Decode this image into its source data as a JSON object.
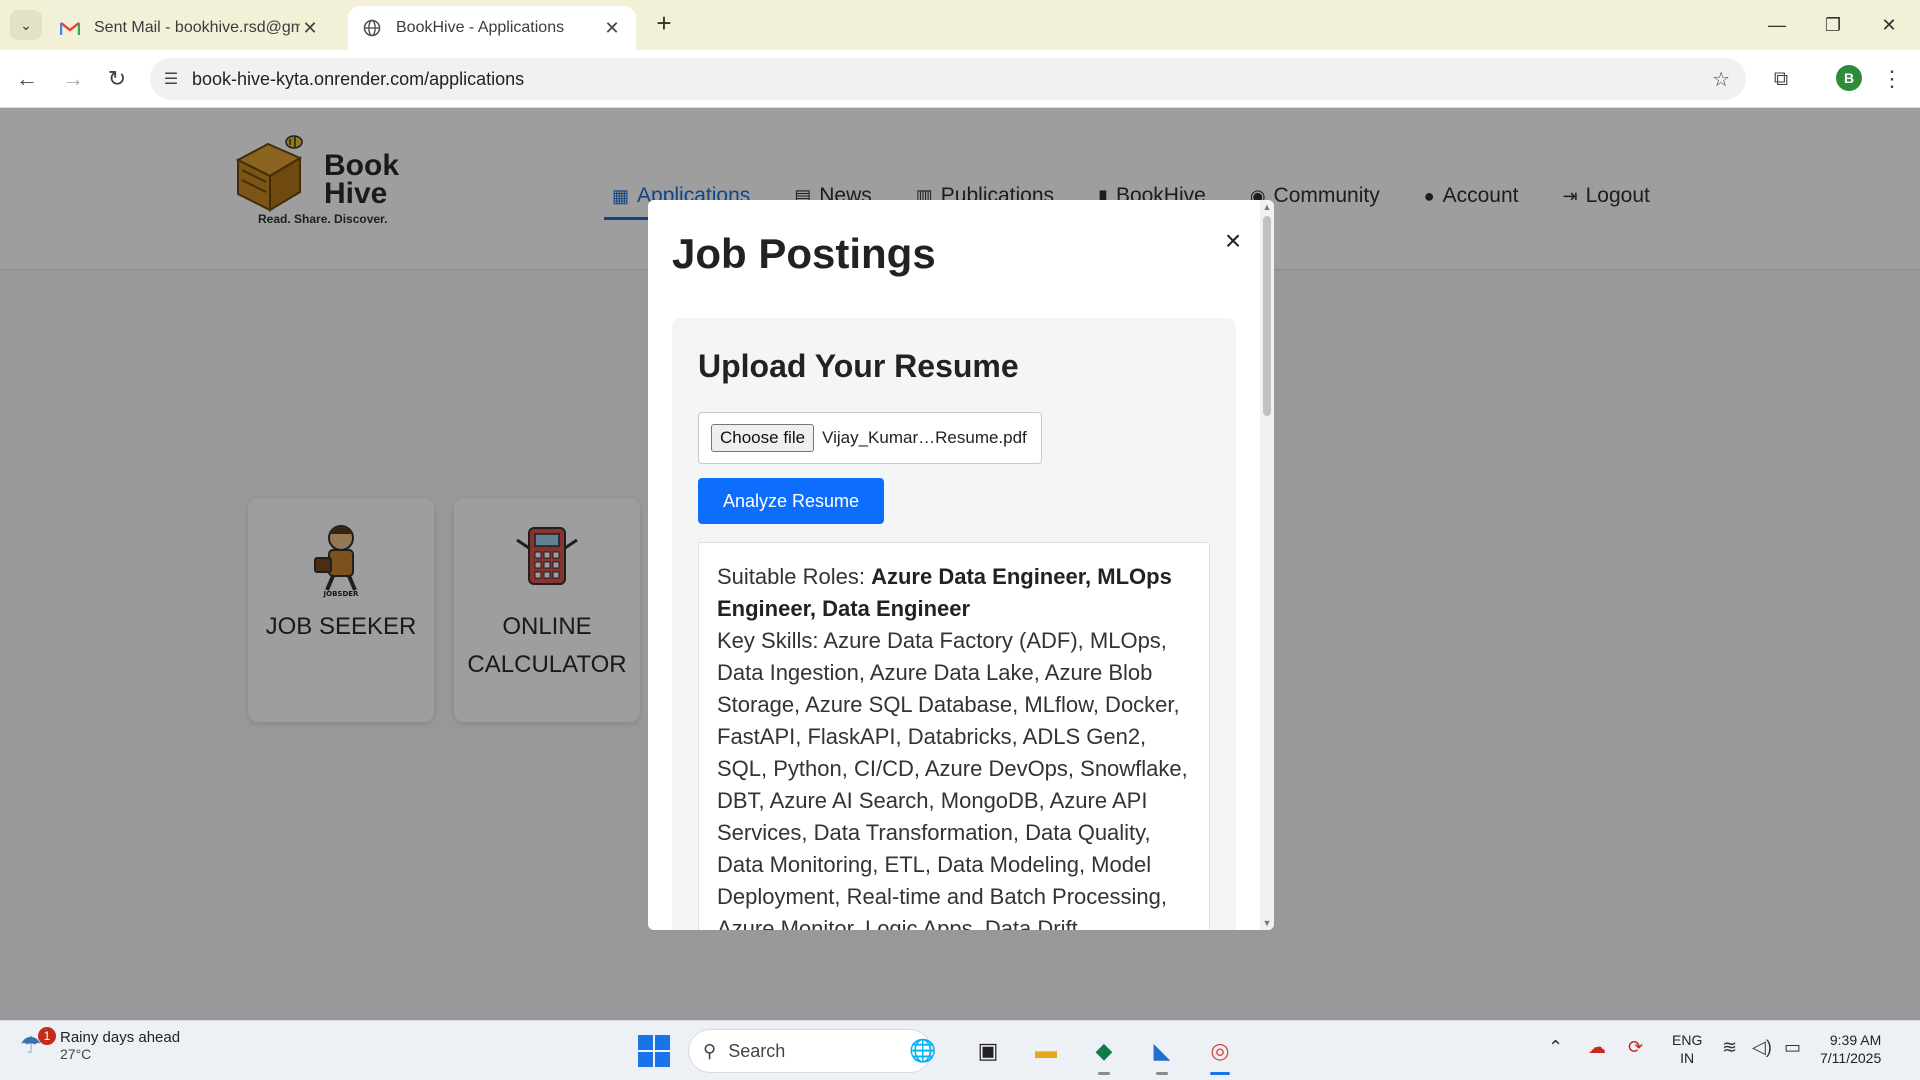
{
  "browser": {
    "tabs": [
      {
        "title": "Sent Mail - bookhive.rsd@gmail.com - Gmail",
        "icon": "gmail-icon",
        "active": false
      },
      {
        "title": "BookHive - Applications",
        "icon": "globe-icon",
        "active": true
      }
    ],
    "url": "book-hive-kyta.onrender.com/applications",
    "profile_initial": "B"
  },
  "site": {
    "logo": {
      "name_line1": "Book",
      "name_line2": "Hive",
      "tagline": "Read. Share. Discover."
    },
    "nav": [
      {
        "label": "Applications",
        "icon": "grid-icon",
        "active": true
      },
      {
        "label": "News",
        "icon": "newspaper-icon",
        "active": false
      },
      {
        "label": "Publications",
        "icon": "book-open-icon",
        "active": false
      },
      {
        "label": "BookHive",
        "icon": "book-icon",
        "active": false
      },
      {
        "label": "Community",
        "icon": "comments-icon",
        "active": false
      },
      {
        "label": "Account",
        "icon": "user-icon",
        "active": false
      },
      {
        "label": "Logout",
        "icon": "logout-icon",
        "active": false
      }
    ],
    "apps": [
      {
        "label": "JOB SEEKER",
        "icon": "job-seeker-icon"
      },
      {
        "label": "ONLINE CALCULATOR",
        "icon": "calculator-icon"
      }
    ]
  },
  "modal": {
    "title": "Job Postings",
    "close_label": "×",
    "upload": {
      "title": "Upload Your Resume",
      "choose_label": "Choose file",
      "file_name": "Vijay_Kumar…Resume.pdf",
      "analyze_label": "Analyze Resume"
    },
    "result": {
      "roles_label": "Suitable Roles:",
      "roles": "Azure Data Engineer, MLOps Engineer, Data Engineer",
      "skills_label": "Key Skills:",
      "skills": "Azure Data Factory (ADF), MLOps, Data Ingestion, Azure Data Lake, Azure Blob Storage, Azure SQL Database, MLflow, Docker, FastAPI, FlaskAPI, Databricks, ADLS Gen2, SQL, Python, CI/CD, Azure DevOps, Snowflake, DBT, Azure AI Search, MongoDB, Azure API Services, Data Transformation, Data Quality, Data Monitoring, ETL, Data Modeling, Model Deployment, Real-time and Batch Processing, Azure Monitor, Logic Apps, Data Drift"
    }
  },
  "taskbar": {
    "weather": {
      "badge": "1",
      "title": "Rainy days ahead",
      "temp": "27°C"
    },
    "search_placeholder": "Search",
    "lang_line1": "ENG",
    "lang_line2": "IN",
    "time": "9:39 AM",
    "date": "7/11/2025"
  },
  "colors": {
    "accent": "#1e6fd9",
    "button": "#0d6efd",
    "tabstrip": "#f2f0d6"
  }
}
